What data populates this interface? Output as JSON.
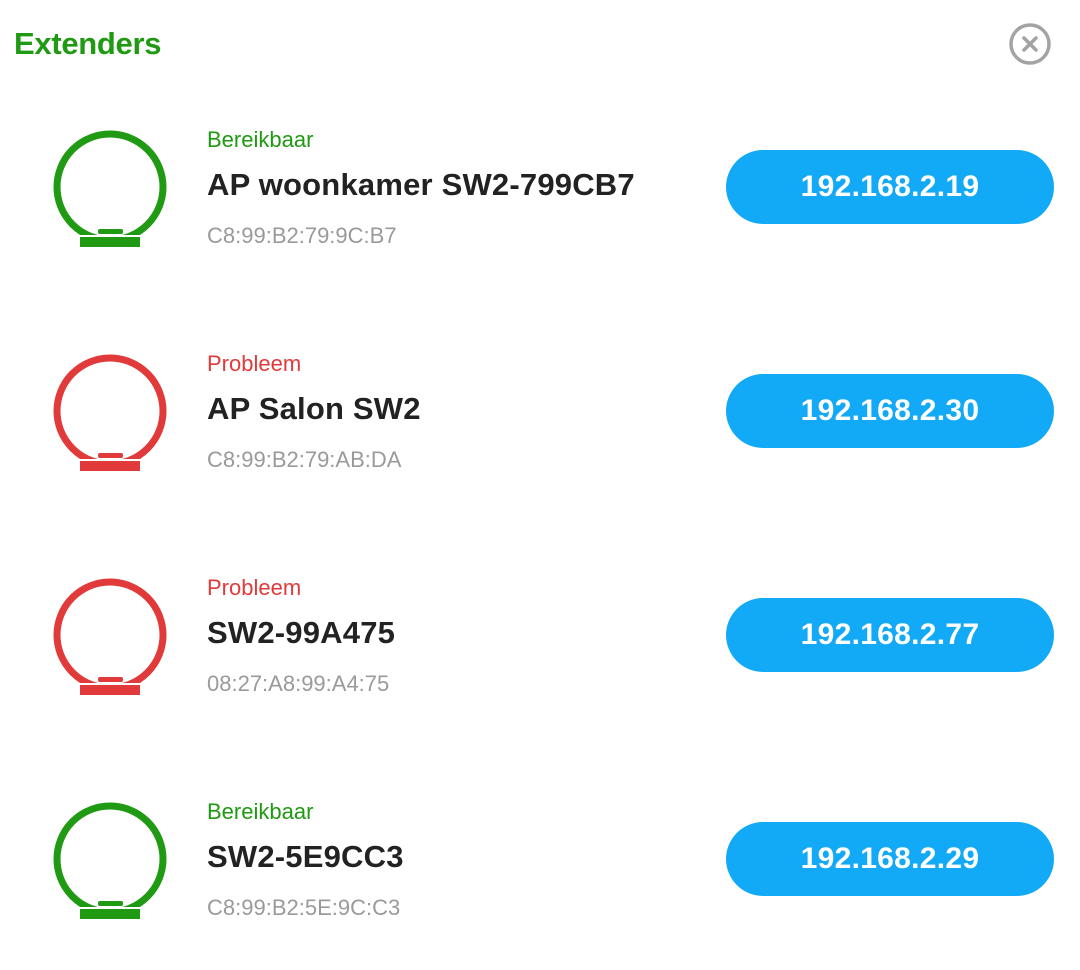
{
  "panel": {
    "title": "Extenders",
    "close_icon": "close-circle-icon"
  },
  "colors": {
    "title": "#1f9a12",
    "reachable": "#1f9a12",
    "problem": "#e13a3a",
    "ip_button": "#12aaf7",
    "mac": "#9a9a9a",
    "name": "#222222"
  },
  "extenders": [
    {
      "status": "Bereikbaar",
      "state": "reachable",
      "name": "AP woonkamer SW2-799CB7",
      "mac": "C8:99:B2:79:9C:B7",
      "ip": "192.168.2.19",
      "icon": "extender-icon"
    },
    {
      "status": "Probleem",
      "state": "problem",
      "name": "AP Salon SW2",
      "mac": "C8:99:B2:79:AB:DA",
      "ip": "192.168.2.30",
      "icon": "extender-icon"
    },
    {
      "status": "Probleem",
      "state": "problem",
      "name": "SW2-99A475",
      "mac": "08:27:A8:99:A4:75",
      "ip": "192.168.2.77",
      "icon": "extender-icon"
    },
    {
      "status": "Bereikbaar",
      "state": "reachable",
      "name": "SW2-5E9CC3",
      "mac": "C8:99:B2:5E:9C:C3",
      "ip": "192.168.2.29",
      "icon": "extender-icon"
    }
  ]
}
